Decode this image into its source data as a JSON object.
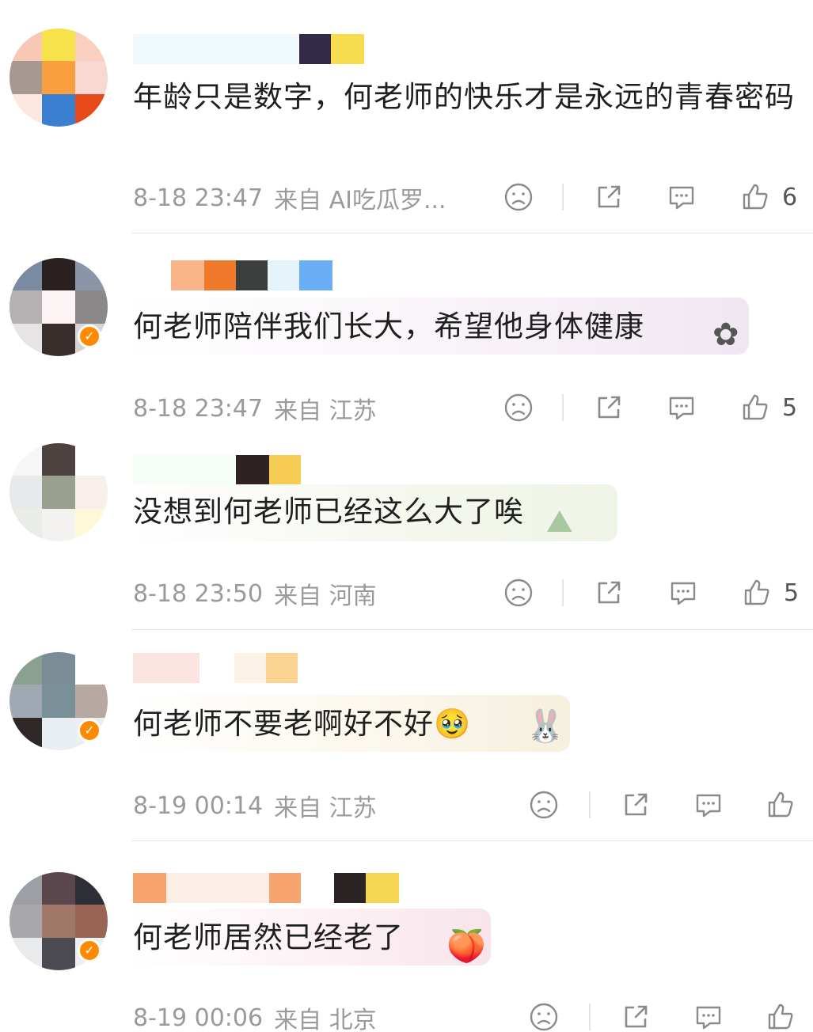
{
  "comments": [
    {
      "content": "年龄只是数字，何老师的快乐才是永远的青春密码",
      "time": "8-18 23:47",
      "source": "来自 AI吃瓜罗...",
      "likes": "6"
    },
    {
      "content": "何老师陪伴我们长大，希望他身体健康",
      "time": "8-18 23:47",
      "source": "来自 江苏",
      "likes": "5"
    },
    {
      "content": "没想到何老师已经这么大了唉",
      "time": "8-18 23:50",
      "source": "来自 河南",
      "likes": "5"
    },
    {
      "content": "何老师不要老啊好不好",
      "emoji": "🥹",
      "time": "8-19 00:14",
      "source": "来自 江苏",
      "likes": ""
    },
    {
      "content": "何老师居然已经老了",
      "time": "8-19 00:06",
      "source": "来自 北京",
      "likes": ""
    }
  ],
  "icons": {
    "dislike": "sad-face-icon",
    "share": "share-icon",
    "reply": "comment-bubble-icon",
    "like": "thumbs-up-icon"
  },
  "colors": {
    "meta_text": "#9a9a9a",
    "verify_badge": "#ff8a00",
    "divider": "#e8e8e8"
  }
}
